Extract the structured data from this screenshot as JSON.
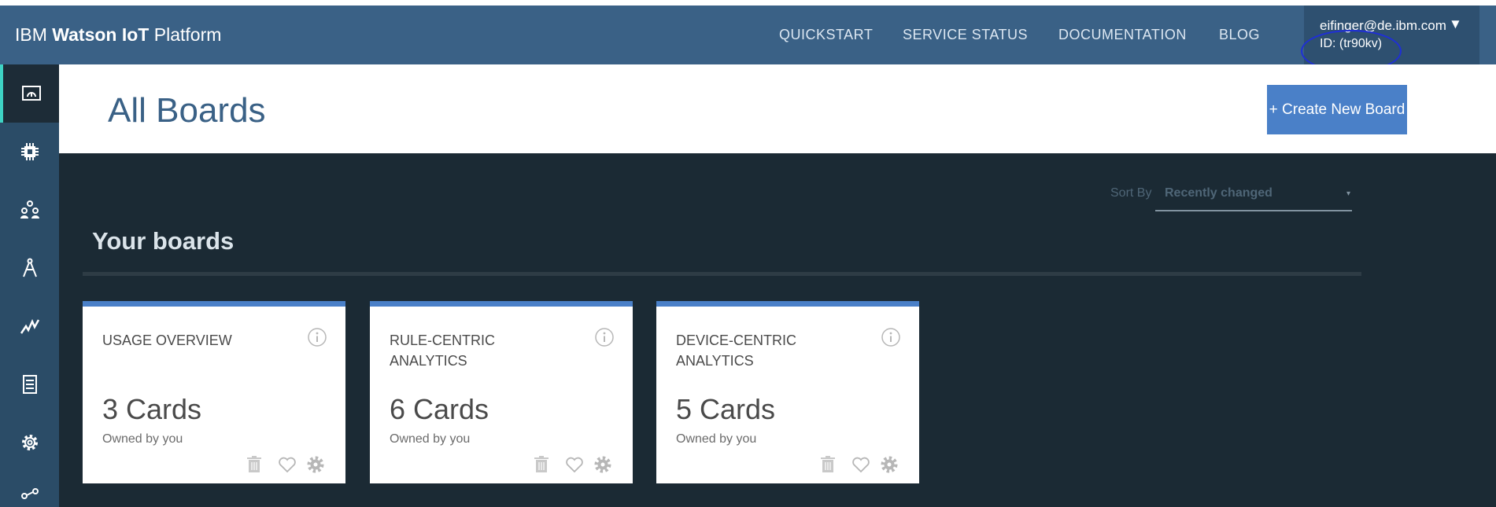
{
  "header": {
    "brand_ibm": "IBM",
    "brand_watson": "Watson IoT",
    "brand_platform": "Platform",
    "nav": [
      "QUICKSTART",
      "SERVICE STATUS",
      "DOCUMENTATION",
      "BLOG"
    ],
    "user_email": "eifinger@de.ibm.com",
    "user_caret": "▼",
    "user_id": "ID: (tr90kv)"
  },
  "sidebar": {
    "items": [
      {
        "icon": "boards-icon",
        "active": true
      },
      {
        "icon": "devices-chip-icon",
        "active": false
      },
      {
        "icon": "members-icon",
        "active": false
      },
      {
        "icon": "apps-compass-icon",
        "active": false
      },
      {
        "icon": "analytics-icon",
        "active": false
      },
      {
        "icon": "usage-document-icon",
        "active": false
      },
      {
        "icon": "settings-gear-icon",
        "active": false
      },
      {
        "icon": "extensions-icon",
        "active": false
      }
    ]
  },
  "page": {
    "title": "All Boards",
    "create_button": "+ Create New Board"
  },
  "sort": {
    "label": "Sort By",
    "value": "Recently changed"
  },
  "section": {
    "title": "Your boards"
  },
  "cards": [
    {
      "title": "USAGE OVERVIEW",
      "count": "3 Cards",
      "owner": "Owned by you"
    },
    {
      "title": "RULE-CENTRIC ANALYTICS",
      "count": "6 Cards",
      "owner": "Owned by you"
    },
    {
      "title": "DEVICE-CENTRIC ANALYTICS",
      "count": "5 Cards",
      "owner": "Owned by you"
    }
  ],
  "colors": {
    "header": "#3a6186",
    "sidebar": "#2b4c67",
    "main_bg": "#1b2a34",
    "accent": "#4a80c8",
    "active_indicator": "#3ed3c4",
    "annotation_circle": "#1f2fd6"
  }
}
